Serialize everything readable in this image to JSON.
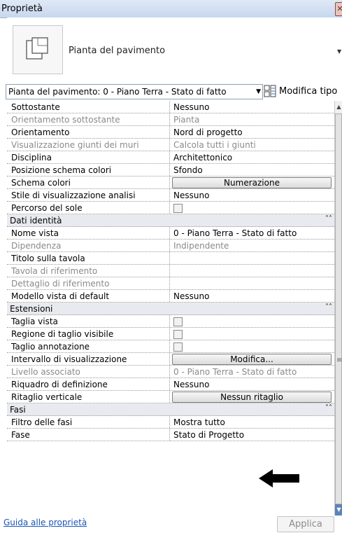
{
  "window": {
    "title": "Proprietà"
  },
  "type_selector": {
    "name": "Pianta del pavimento"
  },
  "instance_selector": {
    "value": "Pianta del pavimento: 0 - Piano Terra - Stato di fatto",
    "edit_type_label": "Modifica tipo"
  },
  "rows": [
    {
      "kind": "prop",
      "name": "Sottostante",
      "value": "Nessuno"
    },
    {
      "kind": "prop",
      "name": "Orientamento sottostante",
      "value": "Pianta",
      "dim": true
    },
    {
      "kind": "prop",
      "name": "Orientamento",
      "value": "Nord di progetto"
    },
    {
      "kind": "prop",
      "name": "Visualizzazione giunti dei muri",
      "value": "Calcola tutti i giunti",
      "dim": true
    },
    {
      "kind": "prop",
      "name": "Disciplina",
      "value": "Architettonico"
    },
    {
      "kind": "prop",
      "name": "Posizione schema colori",
      "value": "Sfondo"
    },
    {
      "kind": "button",
      "name": "Schema colori",
      "value": "Numerazione"
    },
    {
      "kind": "prop",
      "name": "Stile di visualizzazione analisi",
      "value": "Nessuno"
    },
    {
      "kind": "check",
      "name": "Percorso del sole",
      "checked": false
    },
    {
      "kind": "category",
      "name": "Dati identità"
    },
    {
      "kind": "prop",
      "name": "Nome vista",
      "value": "0 - Piano Terra - Stato di fatto"
    },
    {
      "kind": "prop",
      "name": "Dipendenza",
      "value": "Indipendente",
      "dim": true
    },
    {
      "kind": "prop",
      "name": "Titolo sulla tavola",
      "value": ""
    },
    {
      "kind": "prop",
      "name": "Tavola di riferimento",
      "value": "",
      "dim": true
    },
    {
      "kind": "prop",
      "name": "Dettaglio di riferimento",
      "value": "",
      "dim": true
    },
    {
      "kind": "prop",
      "name": "Modello vista di default",
      "value": "Nessuno"
    },
    {
      "kind": "category",
      "name": "Estensioni"
    },
    {
      "kind": "check",
      "name": "Taglia vista",
      "checked": false
    },
    {
      "kind": "check",
      "name": "Regione di taglio visibile",
      "checked": false
    },
    {
      "kind": "check",
      "name": "Taglio annotazione",
      "checked": false
    },
    {
      "kind": "button",
      "name": "Intervallo di visualizzazione",
      "value": "Modifica..."
    },
    {
      "kind": "prop",
      "name": "Livello associato",
      "value": "0 - Piano Terra - Stato di fatto",
      "dim": true
    },
    {
      "kind": "prop",
      "name": "Riquadro di definizione",
      "value": "Nessuno"
    },
    {
      "kind": "button",
      "name": "Ritaglio verticale",
      "value": "Nessun ritaglio"
    },
    {
      "kind": "category",
      "name": "Fasi"
    },
    {
      "kind": "prop",
      "name": "Filtro delle fasi",
      "value": "Mostra tutto"
    },
    {
      "kind": "prop",
      "name": "Fase",
      "value": "Stato di Progetto"
    }
  ],
  "footer": {
    "help_link": "Guida alle proprietà",
    "apply_label": "Applica"
  },
  "icons": [
    "view-type-icon",
    "edit-type-icon",
    "collapse-chevron-icon",
    "scroll-up-icon",
    "scroll-down-icon",
    "pointer-arrow-icon",
    "close-icon"
  ]
}
